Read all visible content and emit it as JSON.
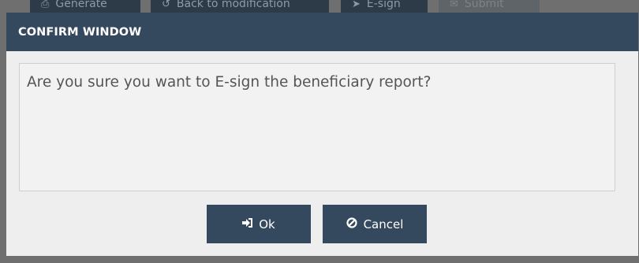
{
  "background_toolbar": {
    "generate_label": "Generate",
    "back_label": "Back to modification",
    "esign_label": "E-sign",
    "submit_label": "Submit"
  },
  "dialog": {
    "title": "CONFIRM WINDOW",
    "message": "Are you sure you want to E-sign the beneficiary report?",
    "ok_label": "Ok",
    "cancel_label": "Cancel"
  },
  "colors": {
    "header_bg": "#34495e",
    "button_bg": "#34495e",
    "overlay": "#6f6f6f"
  },
  "icons": {
    "ok": "sign-in-icon",
    "cancel": "ban-icon"
  }
}
